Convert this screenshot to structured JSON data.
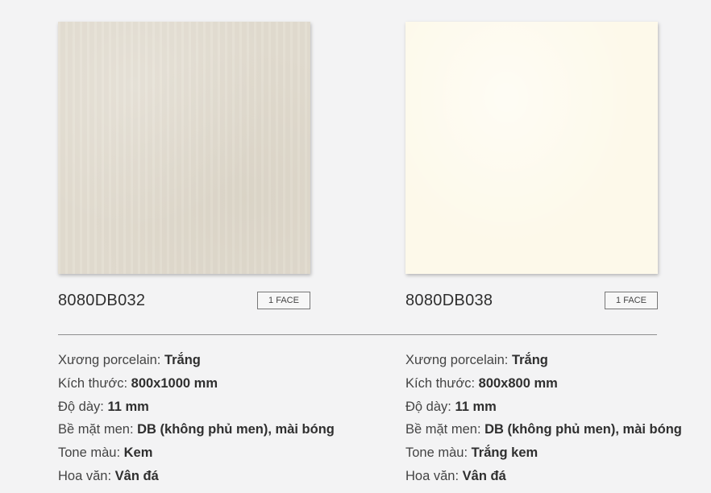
{
  "products": [
    {
      "code": "8080DB032",
      "badge": "1 FACE",
      "swatch_color": "#e3ddd1",
      "specs": [
        {
          "label": "Xương porcelain:",
          "value": "Trắng"
        },
        {
          "label": "Kích thước:",
          "value": "800x1000 mm"
        },
        {
          "label": "Độ dày:",
          "value": "11 mm"
        },
        {
          "label": "Bề mặt men:",
          "value": "DB (không phủ men), mài bóng"
        },
        {
          "label": "Tone màu:",
          "value": "Kem"
        },
        {
          "label": "Hoa văn:",
          "value": "Vân đá"
        }
      ]
    },
    {
      "code": "8080DB038",
      "badge": "1 FACE",
      "swatch_color": "#fdf9ea",
      "specs": [
        {
          "label": "Xương porcelain:",
          "value": "Trắng"
        },
        {
          "label": "Kích thước:",
          "value": "800x800 mm"
        },
        {
          "label": "Độ dày:",
          "value": "11 mm"
        },
        {
          "label": "Bề mặt men:",
          "value": "DB (không phủ men), mài bóng"
        },
        {
          "label": "Tone màu:",
          "value": "Trắng kem"
        },
        {
          "label": "Hoa văn:",
          "value": "Vân đá"
        }
      ]
    }
  ]
}
